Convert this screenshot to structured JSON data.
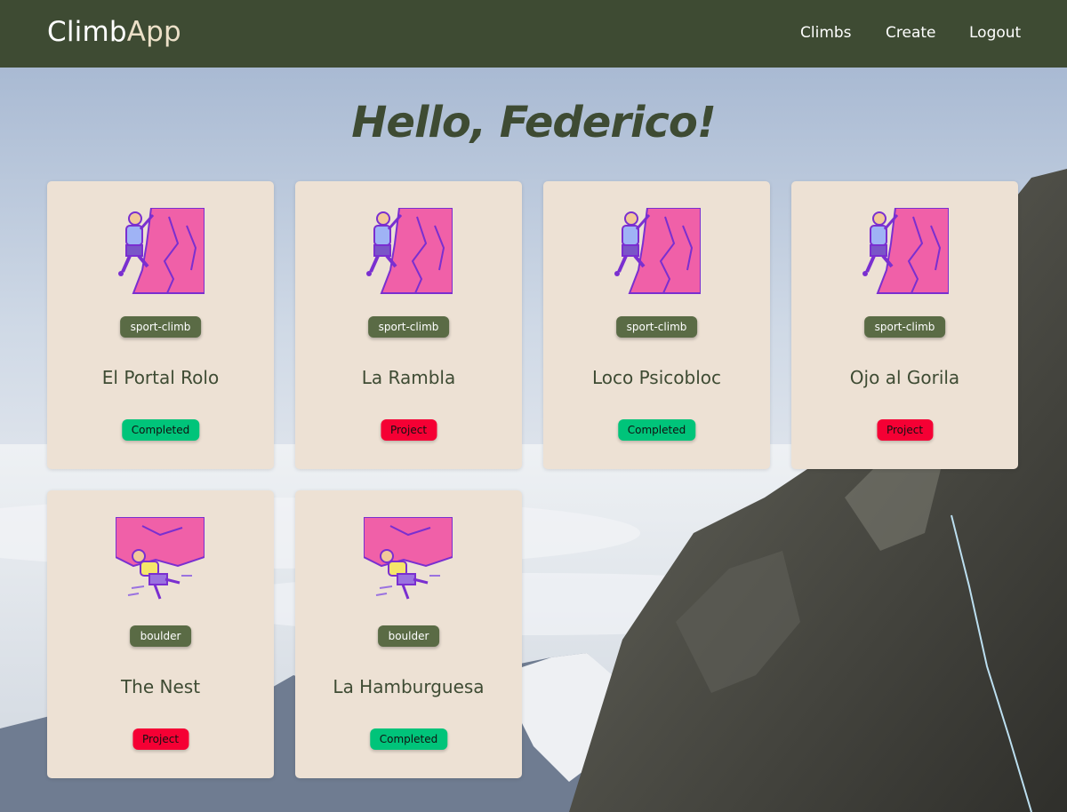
{
  "nav": {
    "brand_part1": "Climb",
    "brand_part2": "App",
    "links": [
      "Climbs",
      "Create",
      "Logout"
    ]
  },
  "greeting": "Hello, Federico!",
  "climbs": [
    {
      "type": "sport-climb",
      "name": "El Portal Rolo",
      "status": "Completed",
      "illustration": "sport-climber-icon"
    },
    {
      "type": "sport-climb",
      "name": "La Rambla",
      "status": "Project",
      "illustration": "sport-climber-icon"
    },
    {
      "type": "sport-climb",
      "name": "Loco Psicobloc",
      "status": "Completed",
      "illustration": "sport-climber-icon"
    },
    {
      "type": "sport-climb",
      "name": "Ojo al Gorila",
      "status": "Project",
      "illustration": "sport-climber-icon"
    },
    {
      "type": "boulder",
      "name": "The Nest",
      "status": "Project",
      "illustration": "boulderer-icon"
    },
    {
      "type": "boulder",
      "name": "La Hamburguesa",
      "status": "Completed",
      "illustration": "boulderer-icon"
    }
  ],
  "colors": {
    "navbar": "#3e4b33",
    "card_bg": "#ede1d4",
    "tag_bg": "#5a6b45",
    "completed": "#00c47a",
    "project": "#f50034"
  }
}
